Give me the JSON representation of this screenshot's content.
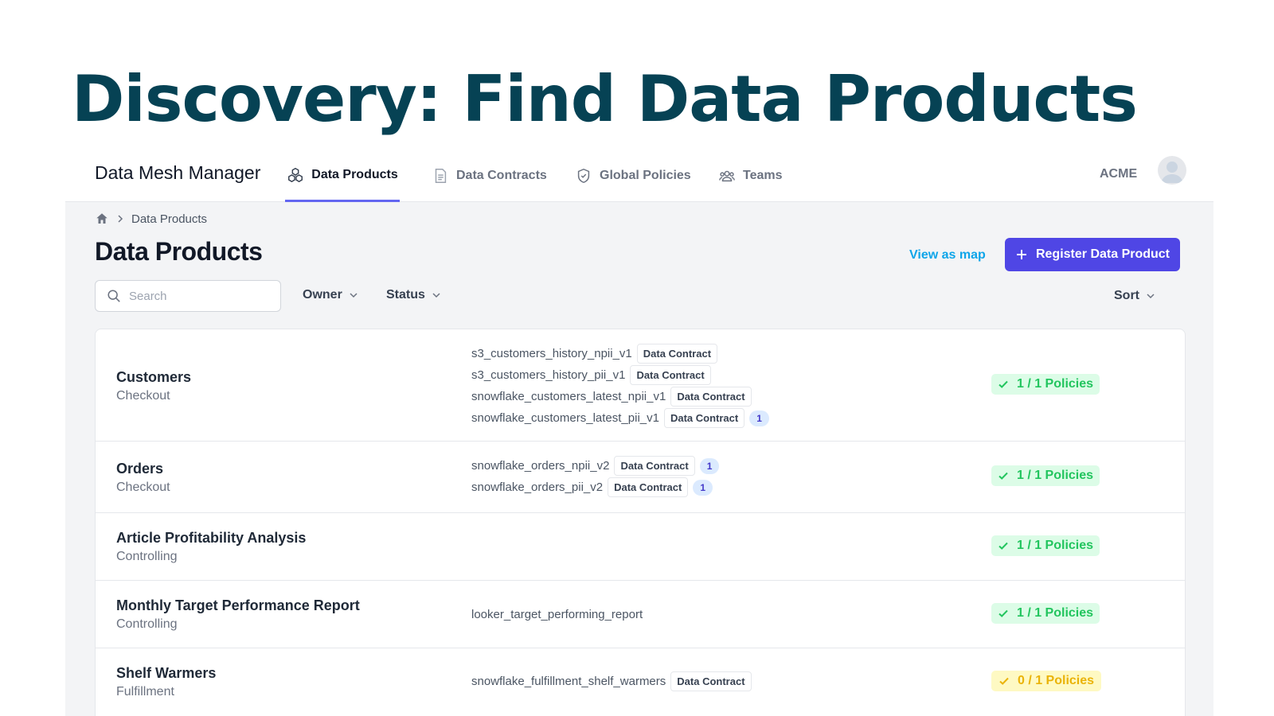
{
  "slide": {
    "title": "Discovery: Find Data Products"
  },
  "nav": {
    "brand": "Data Mesh Manager",
    "tabs": [
      {
        "label": "Data Products",
        "icon": "cubes-icon",
        "active": true
      },
      {
        "label": "Data Contracts",
        "icon": "document-icon",
        "active": false
      },
      {
        "label": "Global Policies",
        "icon": "shield-icon",
        "active": false
      },
      {
        "label": "Teams",
        "icon": "users-icon",
        "active": false
      }
    ],
    "org": "ACME",
    "avatar_icon": "user-avatar-icon"
  },
  "breadcrumb": {
    "home_icon": "home-icon",
    "current": "Data Products"
  },
  "page": {
    "title": "Data Products",
    "view_map": "View as map",
    "register": "Register Data Product"
  },
  "filters": {
    "search_placeholder": "Search",
    "owner": "Owner",
    "status": "Status",
    "sort": "Sort"
  },
  "colors": {
    "accent": "#4f46e5",
    "title": "#064254",
    "ok": "#22c55e",
    "warn": "#eab308",
    "link": "#0ea5e9"
  },
  "products": [
    {
      "name": "Customers",
      "team": "Checkout",
      "outputs": [
        {
          "name": "s3_customers_history_npii_v1",
          "contract": "Data Contract"
        },
        {
          "name": "s3_customers_history_pii_v1",
          "contract": "Data Contract"
        },
        {
          "name": "snowflake_customers_latest_npii_v1",
          "contract": "Data Contract"
        },
        {
          "name": "snowflake_customers_latest_pii_v1",
          "contract": "Data Contract",
          "count": "1"
        }
      ],
      "policies": "1 / 1 Policies",
      "policy_status": "ok"
    },
    {
      "name": "Orders",
      "team": "Checkout",
      "outputs": [
        {
          "name": "snowflake_orders_npii_v2",
          "contract": "Data Contract",
          "count": "1"
        },
        {
          "name": "snowflake_orders_pii_v2",
          "contract": "Data Contract",
          "count": "1"
        }
      ],
      "policies": "1 / 1 Policies",
      "policy_status": "ok"
    },
    {
      "name": "Article Profitability Analysis",
      "team": "Controlling",
      "outputs": [],
      "policies": "1 / 1 Policies",
      "policy_status": "ok"
    },
    {
      "name": "Monthly Target Performance Report",
      "team": "Controlling",
      "outputs": [
        {
          "name": "looker_target_performing_report"
        }
      ],
      "policies": "1 / 1 Policies",
      "policy_status": "ok"
    },
    {
      "name": "Shelf Warmers",
      "team": "Fulfillment",
      "outputs": [
        {
          "name": "snowflake_fulfillment_shelf_warmers",
          "contract": "Data Contract"
        }
      ],
      "policies": "0 / 1 Policies",
      "policy_status": "warn"
    }
  ]
}
